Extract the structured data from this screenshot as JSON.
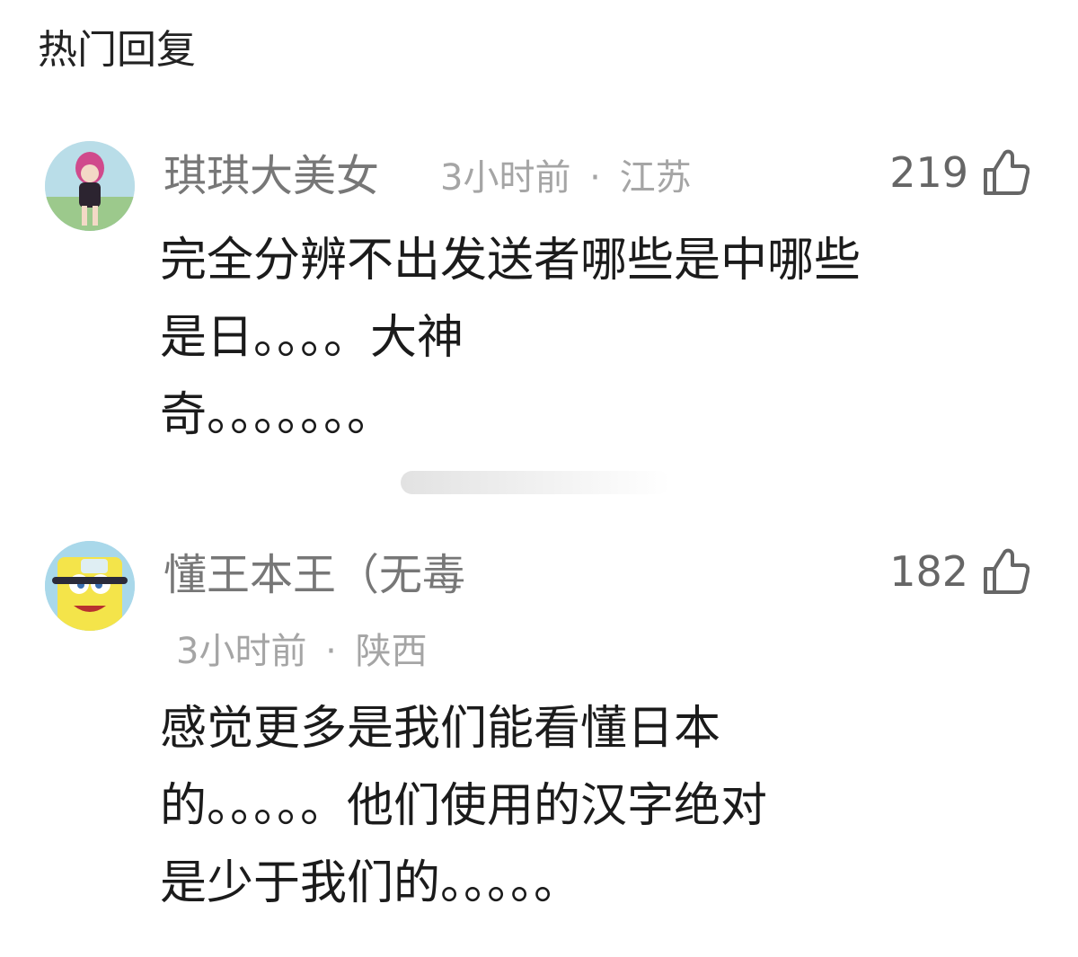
{
  "section": {
    "title": "热门回复"
  },
  "comments": [
    {
      "username": "琪琪大美女",
      "time": "3小时前",
      "separator": "·",
      "location": "江苏",
      "likes": "219",
      "lines": [
        "完全分辨不出发送者哪些是中哪些",
        "是日。。。。大神",
        "奇。。。。。。。"
      ]
    },
    {
      "username": "懂王本王（无毒",
      "time": "3小时前",
      "separator": "·",
      "location": "陕西",
      "likes": "182",
      "lines": [
        "感觉更多是我们能看懂日本",
        "的。。。。。他们使用的汉字绝对",
        "是少于我们的。。。。。"
      ]
    }
  ],
  "icons": {
    "avatar_1": "anime-avatar-icon",
    "avatar_2": "spongebob-avatar-icon",
    "like": "thumbs-up-icon"
  },
  "colors": {
    "username": "#777777",
    "meta": "#a5a5a5",
    "text": "#1b1b1b"
  }
}
